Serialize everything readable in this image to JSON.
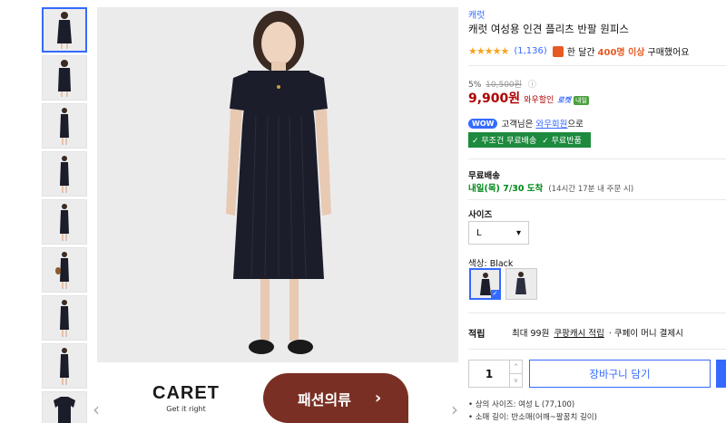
{
  "product": {
    "brand": "캐럿",
    "title": "캐럿 여성용 인견 플리츠 반팔 원피스",
    "review_count": "(1,136)",
    "buy_prefix": "한 달간",
    "buy_count": "400명 이상",
    "buy_suffix": "구매했어요",
    "discount_rate": "5%",
    "original_price": "10,500원",
    "price": "9,900원",
    "wow_sale": "와우할인",
    "rocket": "로켓",
    "rocket_tag": "내일"
  },
  "wow": {
    "badge": "WOW",
    "prefix": "고객님은",
    "link": "와우회원",
    "suffix": "으로",
    "free_shipping": "✓ 무조건 무료배송",
    "free_return": "✓ 무료반품"
  },
  "shipping": {
    "label": "무료배송",
    "date_strong": "내일(목) 7/30 도착",
    "date_note": "(14시간 17분 내 주문 시)"
  },
  "options": {
    "size_label": "사이즈",
    "size_value": "L",
    "color_label": "색상: Black"
  },
  "earn": {
    "label": "적립",
    "prefix": "최대 99원",
    "link": "쿠팡캐시 적립",
    "suffix": "· 쿠페이 머니 결제시"
  },
  "purchase": {
    "qty": "1",
    "cart": "장바구니 담기"
  },
  "specs": [
    "상의 사이즈: 여성 L (77,100)",
    "소매 길이: 반소매(어깨~팔꿈치 길이)"
  ],
  "banner": {
    "logo": "CARET",
    "tagline": "Get it right",
    "category": "패션의류",
    "arrow": "›"
  },
  "colors": {
    "accent": "#346aff",
    "price": "#ae0000",
    "banner_bg": "#7a2f24",
    "free_bg": "#1d8a3e"
  }
}
